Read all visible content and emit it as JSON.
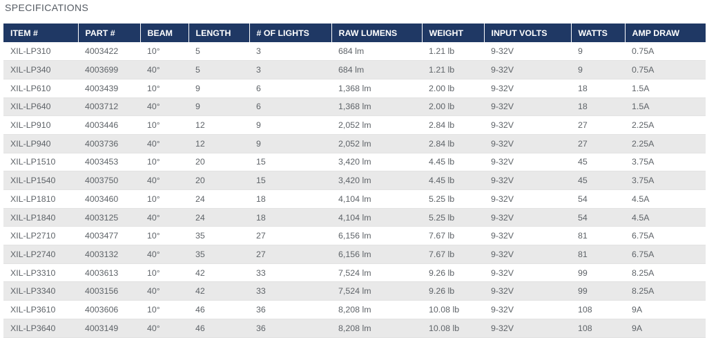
{
  "page": {
    "title": "SPECIFICATIONS"
  },
  "colors": {
    "header_bg": "#1f3864",
    "header_text": "#ffffff",
    "stripe": "#e9e9e9",
    "cell_text": "#5e6368"
  },
  "table": {
    "headers": [
      "ITEM #",
      "PART #",
      "BEAM",
      "LENGTH",
      "# OF LIGHTS",
      "RAW LUMENS",
      "WEIGHT",
      "INPUT VOLTS",
      "WATTS",
      "AMP DRAW"
    ],
    "rows": [
      [
        "XIL-LP310",
        "4003422",
        "10°",
        "5",
        "3",
        "684 lm",
        "1.21 lb",
        "9-32V",
        "9",
        "0.75A"
      ],
      [
        "XIL-LP340",
        "4003699",
        "40°",
        "5",
        "3",
        "684 lm",
        "1.21 lb",
        "9-32V",
        "9",
        "0.75A"
      ],
      [
        "XIL-LP610",
        "4003439",
        "10°",
        "9",
        "6",
        "1,368 lm",
        "2.00 lb",
        "9-32V",
        "18",
        "1.5A"
      ],
      [
        "XIL-LP640",
        "4003712",
        "40°",
        "9",
        "6",
        "1,368 lm",
        "2.00 lb",
        "9-32V",
        "18",
        "1.5A"
      ],
      [
        "XIL-LP910",
        "4003446",
        "10°",
        "12",
        "9",
        "2,052 lm",
        "2.84 lb",
        "9-32V",
        "27",
        "2.25A"
      ],
      [
        "XIL-LP940",
        "4003736",
        "40°",
        "12",
        "9",
        "2,052 lm",
        "2.84 lb",
        "9-32V",
        "27",
        "2.25A"
      ],
      [
        "XIL-LP1510",
        "4003453",
        "10°",
        "20",
        "15",
        "3,420 lm",
        "4.45 lb",
        "9-32V",
        "45",
        "3.75A"
      ],
      [
        "XIL-LP1540",
        "4003750",
        "40°",
        "20",
        "15",
        "3,420 lm",
        "4.45 lb",
        "9-32V",
        "45",
        "3.75A"
      ],
      [
        "XIL-LP1810",
        "4003460",
        "10°",
        "24",
        "18",
        "4,104 lm",
        "5.25 lb",
        "9-32V",
        "54",
        "4.5A"
      ],
      [
        "XIL-LP1840",
        "4003125",
        "40°",
        "24",
        "18",
        "4,104 lm",
        "5.25 lb",
        "9-32V",
        "54",
        "4.5A"
      ],
      [
        "XIL-LP2710",
        "4003477",
        "10°",
        "35",
        "27",
        "6,156 lm",
        "7.67 lb",
        "9-32V",
        "81",
        "6.75A"
      ],
      [
        "XIL-LP2740",
        "4003132",
        "40°",
        "35",
        "27",
        "6,156 lm",
        "7.67 lb",
        "9-32V",
        "81",
        "6.75A"
      ],
      [
        "XIL-LP3310",
        "4003613",
        "10°",
        "42",
        "33",
        "7,524 lm",
        "9.26 lb",
        "9-32V",
        "99",
        "8.25A"
      ],
      [
        "XIL-LP3340",
        "4003156",
        "40°",
        "42",
        "33",
        "7,524 lm",
        "9.26 lb",
        "9-32V",
        "99",
        "8.25A"
      ],
      [
        "XIL-LP3610",
        "4003606",
        "10°",
        "46",
        "36",
        "8,208 lm",
        "10.08 lb",
        "9-32V",
        "108",
        "9A"
      ],
      [
        "XIL-LP3640",
        "4003149",
        "40°",
        "46",
        "36",
        "8,208 lm",
        "10.08 lb",
        "9-32V",
        "108",
        "9A"
      ]
    ]
  }
}
